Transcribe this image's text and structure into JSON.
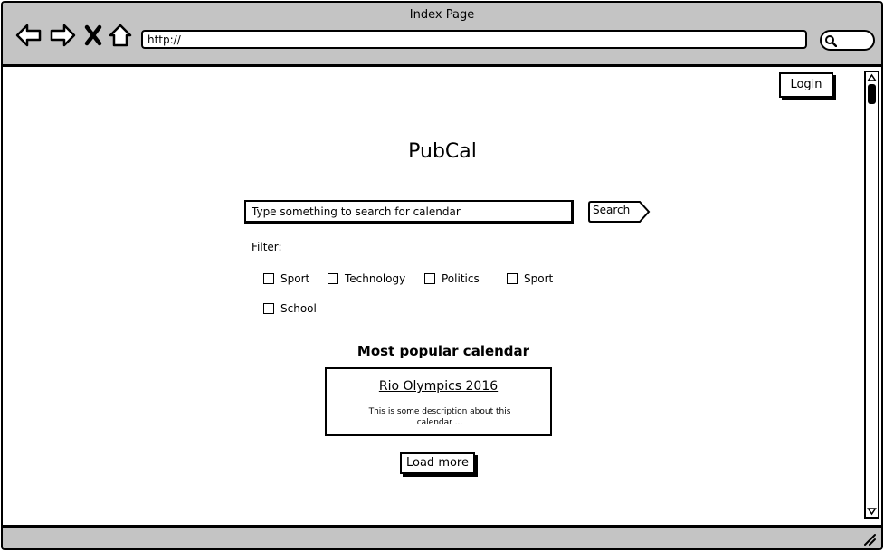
{
  "window": {
    "title": "Index Page"
  },
  "browser": {
    "url": "http://",
    "nav": [
      "back-arrow-icon",
      "forward-arrow-icon",
      "stop-icon",
      "home-icon"
    ]
  },
  "header": {
    "login_label": "Login"
  },
  "app": {
    "title": "PubCal"
  },
  "search": {
    "placeholder": "Type something to search for calendar",
    "button_label": "Search"
  },
  "filter": {
    "label": "Filter:",
    "options": [
      {
        "label": "Sport",
        "checked": false
      },
      {
        "label": "Technology",
        "checked": false
      },
      {
        "label": "Politics",
        "checked": false
      },
      {
        "label": "Sport",
        "checked": false
      },
      {
        "label": "School",
        "checked": false
      }
    ]
  },
  "popular": {
    "heading": "Most popular calendar",
    "card": {
      "title": "Rio Olympics 2016",
      "description": "This is some description about this calendar ..."
    },
    "load_more_label": "Load more"
  }
}
